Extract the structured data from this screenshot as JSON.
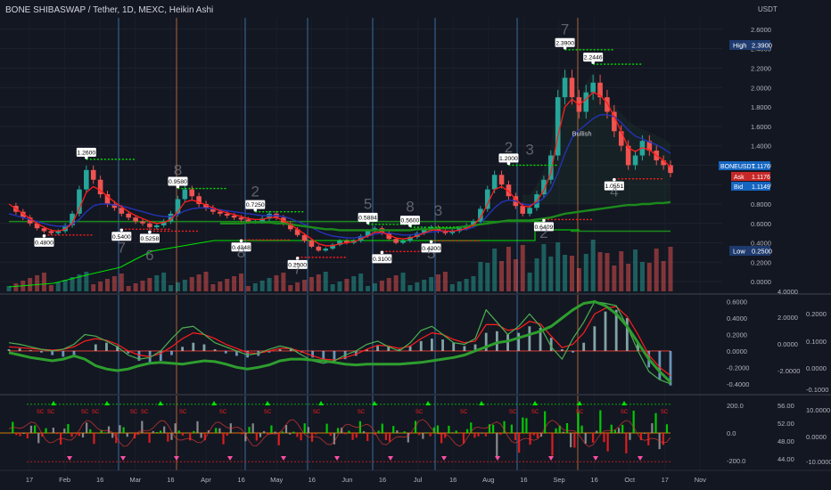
{
  "header": {
    "title": "BONE SHIBASWAP / Tether, 1D, MEXC, Heikin Ashi"
  },
  "price_axis": {
    "currency": "USDT"
  },
  "badges": {
    "high_label": "High",
    "high_value": "2.3900",
    "symbol_label": "BONEUSDT",
    "symbol_value": "1.1176",
    "ask_label": "Ask",
    "ask_value": "1.1176",
    "bid_label": "Bid",
    "bid_value": "1.1149",
    "low_label": "Low",
    "low_value": "0.2500"
  },
  "colors": {
    "background": "#131722",
    "up": "#26a69a",
    "down": "#ef5350",
    "green": "#00e600",
    "red": "#ff1e1e",
    "navy": "#2433b5",
    "dark_green": "#1b8a1b",
    "badge_blue": "#1e3a6e",
    "badge_red": "#c62828",
    "badge_teal": "#1565c0"
  },
  "chart_data": [
    {
      "type": "line",
      "panel": "price",
      "ylim": [
        -0.1,
        2.7
      ],
      "yticks": [
        "2.6000",
        "2.4000",
        "2.2000",
        "2.0000",
        "1.8000",
        "1.6000",
        "1.4000",
        "1.2000",
        "1.0000",
        "0.8000",
        "0.6000",
        "0.4000",
        "0.2000",
        "0.0000"
      ],
      "xticks": [
        "17",
        "Feb",
        "16",
        "Mar",
        "16",
        "Apr",
        "16",
        "May",
        "16",
        "Jun",
        "16",
        "Jul",
        "16",
        "Aug",
        "16",
        "Sep",
        "16",
        "Oct",
        "17",
        "Nov"
      ],
      "series": [
        {
          "key": "close",
          "values": [
            0.78,
            0.72,
            0.66,
            0.6,
            0.55,
            0.52,
            0.5,
            0.52,
            0.58,
            0.7,
            0.95,
            1.15,
            1.05,
            0.9,
            0.8,
            0.76,
            0.7,
            0.66,
            0.62,
            0.6,
            0.56,
            0.58,
            0.62,
            0.7,
            0.85,
            0.95,
            0.88,
            0.8,
            0.76,
            0.72,
            0.7,
            0.68,
            0.66,
            0.64,
            0.62,
            0.62,
            0.65,
            0.7,
            0.66,
            0.6,
            0.54,
            0.48,
            0.42,
            0.36,
            0.32,
            0.34,
            0.38,
            0.42,
            0.4,
            0.42,
            0.47,
            0.52,
            0.55,
            0.5,
            0.44,
            0.4,
            0.42,
            0.46,
            0.5,
            0.54,
            0.56,
            0.52,
            0.5,
            0.52,
            0.55,
            0.58,
            0.62,
            0.75,
            0.95,
            1.1,
            1.0,
            0.88,
            0.78,
            0.7,
            0.76,
            0.9,
            1.05,
            1.3,
            1.9,
            2.1,
            1.9,
            1.75,
            1.95,
            2.05,
            1.9,
            1.75,
            1.55,
            1.4,
            1.2,
            1.3,
            1.45,
            1.35,
            1.25,
            1.2,
            1.12
          ]
        },
        {
          "key": "ma_fast_red",
          "values": [
            0.8,
            0.75,
            0.7,
            0.65,
            0.6,
            0.56,
            0.53,
            0.52,
            0.54,
            0.6,
            0.75,
            0.92,
            0.98,
            0.94,
            0.88,
            0.82,
            0.77,
            0.72,
            0.68,
            0.65,
            0.62,
            0.6,
            0.61,
            0.64,
            0.72,
            0.82,
            0.84,
            0.82,
            0.79,
            0.76,
            0.73,
            0.71,
            0.69,
            0.67,
            0.65,
            0.64,
            0.64,
            0.66,
            0.66,
            0.63,
            0.59,
            0.54,
            0.49,
            0.44,
            0.39,
            0.37,
            0.37,
            0.39,
            0.4,
            0.41,
            0.44,
            0.47,
            0.51,
            0.51,
            0.48,
            0.45,
            0.44,
            0.45,
            0.47,
            0.5,
            0.53,
            0.53,
            0.52,
            0.52,
            0.53,
            0.55,
            0.58,
            0.66,
            0.8,
            0.95,
            0.98,
            0.93,
            0.85,
            0.78,
            0.77,
            0.83,
            0.94,
            1.12,
            1.5,
            1.8,
            1.88,
            1.82,
            1.88,
            1.95,
            1.92,
            1.84,
            1.7,
            1.55,
            1.38,
            1.34,
            1.38,
            1.36,
            1.3,
            1.25,
            1.18
          ]
        },
        {
          "key": "ma_slow_navy",
          "values": [
            0.7,
            0.68,
            0.66,
            0.64,
            0.62,
            0.6,
            0.58,
            0.57,
            0.57,
            0.59,
            0.64,
            0.72,
            0.78,
            0.8,
            0.8,
            0.79,
            0.78,
            0.76,
            0.74,
            0.72,
            0.7,
            0.68,
            0.67,
            0.67,
            0.69,
            0.73,
            0.75,
            0.76,
            0.76,
            0.75,
            0.74,
            0.73,
            0.72,
            0.71,
            0.7,
            0.69,
            0.68,
            0.68,
            0.68,
            0.67,
            0.65,
            0.62,
            0.59,
            0.56,
            0.52,
            0.49,
            0.47,
            0.46,
            0.45,
            0.45,
            0.46,
            0.47,
            0.49,
            0.5,
            0.5,
            0.49,
            0.48,
            0.48,
            0.49,
            0.5,
            0.51,
            0.52,
            0.52,
            0.52,
            0.53,
            0.54,
            0.56,
            0.6,
            0.68,
            0.76,
            0.82,
            0.84,
            0.83,
            0.8,
            0.79,
            0.81,
            0.86,
            0.95,
            1.12,
            1.32,
            1.48,
            1.56,
            1.62,
            1.68,
            1.72,
            1.72,
            1.7,
            1.64,
            1.56,
            1.5,
            1.47,
            1.44,
            1.41,
            1.37,
            1.32
          ]
        },
        {
          "key": "ma_long_green",
          "values": [
            null,
            null,
            null,
            null,
            null,
            null,
            null,
            null,
            null,
            null,
            null,
            null,
            null,
            null,
            null,
            null,
            null,
            null,
            null,
            null,
            null,
            null,
            null,
            null,
            null,
            null,
            null,
            null,
            null,
            null,
            0.6,
            0.6,
            0.6,
            0.6,
            0.61,
            0.61,
            0.61,
            0.61,
            0.6,
            0.6,
            0.59,
            0.58,
            0.57,
            0.56,
            0.55,
            0.54,
            0.54,
            0.53,
            0.53,
            0.53,
            0.53,
            0.53,
            0.53,
            0.53,
            0.53,
            0.53,
            0.53,
            0.53,
            0.54,
            0.54,
            0.54,
            0.55,
            0.55,
            0.55,
            0.56,
            0.57,
            0.58,
            0.59,
            0.6,
            0.61,
            0.62,
            0.63,
            0.63,
            0.63,
            0.63,
            0.64,
            0.65,
            0.66,
            0.68,
            0.7,
            0.71,
            0.72,
            0.73,
            0.74,
            0.75,
            0.76,
            0.77,
            0.78,
            0.79,
            0.79,
            0.8,
            0.8,
            0.81,
            0.81,
            0.82
          ]
        }
      ],
      "annotations": [
        {
          "label": "0.4800",
          "x": 5,
          "y": 0.48,
          "pos": "below"
        },
        {
          "label": "1.2600",
          "x": 11,
          "y": 1.26,
          "pos": "above"
        },
        {
          "label": "0.5400",
          "x": 16,
          "y": 0.54,
          "pos": "below"
        },
        {
          "label": "0.5258",
          "x": 20,
          "y": 0.52,
          "pos": "below"
        },
        {
          "label": "0.9580",
          "x": 24,
          "y": 0.96,
          "pos": "above"
        },
        {
          "label": "0.7250",
          "x": 35,
          "y": 0.72,
          "pos": "above"
        },
        {
          "label": "0.4348",
          "x": 33,
          "y": 0.43,
          "pos": "below"
        },
        {
          "label": "0.2500",
          "x": 41,
          "y": 0.25,
          "pos": "below"
        },
        {
          "label": "0.5884",
          "x": 51,
          "y": 0.59,
          "pos": "above"
        },
        {
          "label": "0.3100",
          "x": 53,
          "y": 0.31,
          "pos": "below"
        },
        {
          "label": "0.5600",
          "x": 57,
          "y": 0.56,
          "pos": "above"
        },
        {
          "label": "0.4200",
          "x": 60,
          "y": 0.42,
          "pos": "below"
        },
        {
          "label": "1.2000",
          "x": 71,
          "y": 1.2,
          "pos": "above"
        },
        {
          "label": "0.6409",
          "x": 76,
          "y": 0.64,
          "pos": "below"
        },
        {
          "label": "2.3900",
          "x": 79,
          "y": 2.39,
          "pos": "above"
        },
        {
          "label": "2.2446",
          "x": 83,
          "y": 2.24,
          "pos": "above"
        },
        {
          "label": "1.0551",
          "x": 86,
          "y": 1.06,
          "pos": "below"
        }
      ],
      "wave_labels": [
        {
          "label": "7",
          "x": 16,
          "y": 0.3
        },
        {
          "label": "6",
          "x": 20,
          "y": 0.22
        },
        {
          "label": "8",
          "x": 24,
          "y": 1.1
        },
        {
          "label": "2",
          "x": 35,
          "y": 0.88
        },
        {
          "label": "8",
          "x": 33,
          "y": 0.25
        },
        {
          "label": "7",
          "x": 41,
          "y": 0.08
        },
        {
          "label": "5",
          "x": 51,
          "y": 0.75
        },
        {
          "label": "8",
          "x": 57,
          "y": 0.72
        },
        {
          "label": "3",
          "x": 61,
          "y": 0.68
        },
        {
          "label": "5",
          "x": 60,
          "y": 0.24
        },
        {
          "label": "2",
          "x": 71,
          "y": 1.33
        },
        {
          "label": "3",
          "x": 74,
          "y": 1.31
        },
        {
          "label": "2",
          "x": 76,
          "y": 0.45
        },
        {
          "label": "7",
          "x": 79,
          "y": 2.55
        },
        {
          "label": "4",
          "x": 86,
          "y": 0.88
        }
      ],
      "text_annotations": [
        {
          "label": "Bullish",
          "x": 80,
          "y": 1.5
        }
      ]
    },
    {
      "type": "line",
      "panel": "oscillator_1",
      "ylim": [
        -0.5,
        0.65
      ],
      "yticks_left": [
        "0.6000",
        "0.4000",
        "0.2000",
        "0.0000",
        "-0.2000",
        "-0.4000"
      ],
      "yticks_mid": [
        "4.0000",
        "2.0000",
        "0.0000",
        "-2.0000"
      ],
      "yticks_right": [
        "0.2000",
        "0.1000",
        "0.0000",
        "-0.1000"
      ],
      "series": [
        {
          "key": "green_line",
          "values": [
            0.1,
            0.08,
            0.05,
            0.02,
            0.0,
            0.02,
            0.08,
            0.2,
            0.18,
            0.12,
            0.05,
            -0.05,
            -0.1,
            -0.08,
            0.0,
            0.15,
            0.28,
            0.3,
            0.2,
            0.1,
            0.05,
            0.0,
            -0.05,
            -0.03,
            0.02,
            0.06,
            0.03,
            -0.05,
            -0.12,
            -0.15,
            -0.12,
            -0.05,
            0.0,
            0.08,
            0.12,
            0.05,
            0.0,
            0.1,
            0.25,
            0.3,
            0.2,
            0.1,
            0.08,
            0.15,
            0.5,
            0.35,
            0.2,
            0.3,
            0.45,
            0.3,
            0.05,
            -0.1,
            0.15,
            0.35,
            0.6,
            0.58,
            0.55,
            0.3,
            0.0,
            -0.25,
            -0.35,
            -0.4
          ]
        },
        {
          "key": "red_line",
          "values": [
            0.05,
            0.04,
            0.03,
            0.02,
            0.01,
            0.02,
            0.05,
            0.12,
            0.15,
            0.13,
            0.08,
            0.0,
            -0.05,
            -0.07,
            -0.03,
            0.05,
            0.15,
            0.22,
            0.2,
            0.15,
            0.08,
            0.03,
            -0.02,
            -0.03,
            0.0,
            0.03,
            0.03,
            -0.01,
            -0.06,
            -0.1,
            -0.11,
            -0.08,
            -0.04,
            0.02,
            0.07,
            0.06,
            0.03,
            0.06,
            0.15,
            0.22,
            0.2,
            0.14,
            0.1,
            0.12,
            0.32,
            0.32,
            0.25,
            0.27,
            0.36,
            0.33,
            0.18,
            0.04,
            0.08,
            0.22,
            0.45,
            0.52,
            0.54,
            0.42,
            0.2,
            -0.05,
            -0.2,
            -0.3
          ]
        },
        {
          "key": "thick_signal",
          "values": [
            -0.02,
            -0.05,
            -0.08,
            -0.1,
            -0.12,
            -0.1,
            -0.06,
            -0.1,
            -0.18,
            -0.22,
            -0.24,
            -0.22,
            -0.18,
            -0.15,
            -0.14,
            -0.15,
            -0.16,
            -0.14,
            -0.12,
            -0.13,
            -0.16,
            -0.2,
            -0.22,
            -0.2,
            -0.17,
            -0.12,
            -0.1,
            -0.1,
            -0.11,
            -0.12,
            -0.14,
            -0.16,
            -0.17,
            -0.16,
            -0.16,
            -0.16,
            -0.16,
            -0.15,
            -0.14,
            -0.12,
            -0.1,
            -0.08,
            -0.05,
            0.0,
            0.05,
            0.1,
            0.12,
            0.16,
            0.2,
            0.24,
            0.3,
            0.4,
            0.5,
            0.58,
            0.6,
            0.55,
            0.45,
            0.3,
            0.1,
            -0.1,
            -0.25,
            -0.38
          ]
        },
        {
          "key": "histogram",
          "values": [
            0.02,
            0.03,
            0.01,
            -0.02,
            -0.05,
            -0.07,
            -0.05,
            0.0,
            0.08,
            0.1,
            0.06,
            -0.03,
            -0.12,
            -0.15,
            -0.12,
            -0.05,
            0.05,
            0.1,
            0.08,
            0.02,
            -0.03,
            -0.06,
            -0.08,
            -0.06,
            -0.02,
            0.02,
            0.03,
            -0.02,
            -0.08,
            -0.12,
            -0.14,
            -0.1,
            -0.06,
            0.02,
            0.06,
            0.05,
            0.02,
            0.06,
            0.12,
            0.15,
            0.14,
            0.1,
            0.06,
            0.08,
            0.22,
            0.24,
            0.2,
            0.22,
            0.3,
            0.28,
            0.16,
            0.02,
            -0.02,
            0.1,
            0.3,
            0.48,
            0.5,
            0.4,
            0.1,
            -0.2,
            -0.35,
            -0.42
          ]
        }
      ]
    },
    {
      "type": "bar",
      "panel": "oscillator_2",
      "ylim": [
        -260,
        260
      ],
      "yticks_left": [
        "200.0",
        "0.0",
        "-200.0"
      ],
      "yticks_mid": [
        "56.00",
        "52.00",
        "48.00",
        "44.00"
      ],
      "yticks_right": [
        "10.0000",
        "0.0000",
        "-10.0000"
      ],
      "signal_labels": [
        "SC",
        "SC",
        "SC",
        "SC",
        "SC",
        "SC",
        "SC",
        "SC",
        "SC",
        "SC",
        "SC",
        "SC",
        "SC",
        "SC",
        "SC",
        "SC",
        "SC",
        "SC"
      ]
    }
  ]
}
